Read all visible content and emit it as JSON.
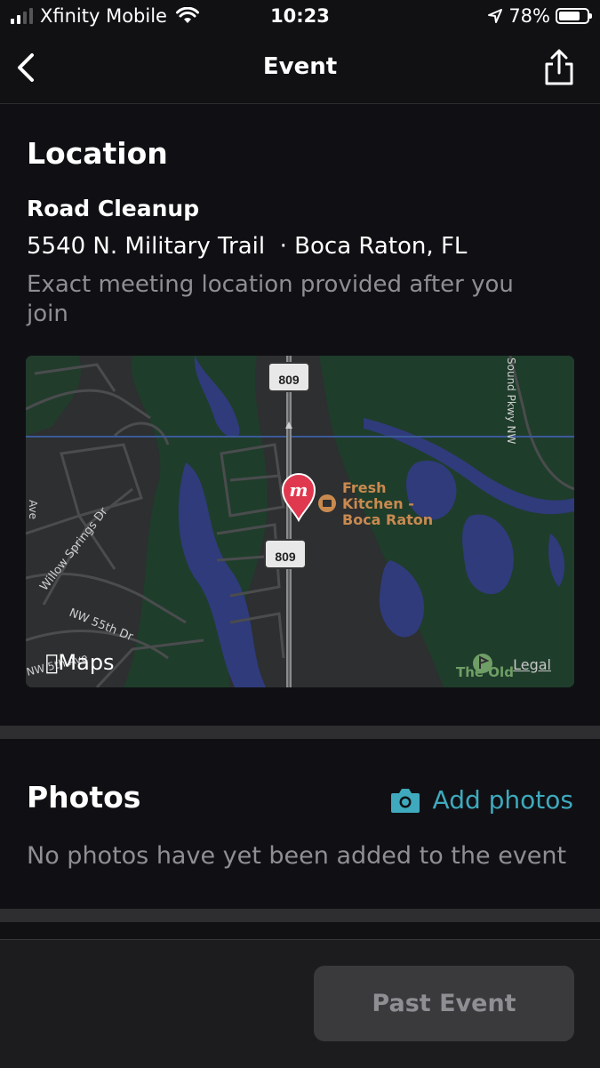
{
  "status_bar": {
    "carrier": "Xfinity Mobile",
    "time": "10:23",
    "battery": "78%",
    "battery_level": 0.78,
    "icons": [
      "signal-icon",
      "wifi-icon",
      "location-arrow-icon",
      "battery-icon"
    ]
  },
  "navbar": {
    "title": "Event",
    "back_icon": "chevron-left-icon",
    "share_icon": "share-icon"
  },
  "location": {
    "heading": "Location",
    "event_name": "Road Cleanup",
    "address": "5540 N. Military Trail  · Boca Raton, FL",
    "hint": "Exact meeting location provided after you join",
    "map": {
      "road_shield_top": "809",
      "road_shield_bottom": "809",
      "poi_line1": "Fresh",
      "poi_line2": "Kitchen -",
      "poi_line3": "Boca Raton",
      "street_willow": "Willow Springs Dr",
      "street_55th": "NW 55th Dr",
      "street_ave": "NW 5th Ave",
      "street_left": "Ave",
      "street_sound": "Sound Pkwy NW",
      "golf_label": "The Old",
      "legal": "Legal",
      "maps_logo": "Maps",
      "marker_letter": "m"
    }
  },
  "photos": {
    "heading": "Photos",
    "add_label": "Add photos",
    "empty_text": "No photos have yet been added to the event"
  },
  "footer": {
    "button_label": "Past Event"
  },
  "colors": {
    "background": "#111113",
    "accent": "#3fa9bd",
    "marker": "#e0394f",
    "poi": "#c98a50",
    "water": "#2f3b7a",
    "vegetation": "#1f3d2b"
  }
}
